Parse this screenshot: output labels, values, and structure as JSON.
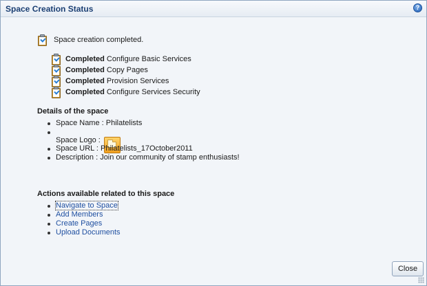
{
  "dialog": {
    "title": "Space Creation Status",
    "help_icon": "help-icon",
    "help_glyph": "?"
  },
  "status": {
    "message": "Space creation completed.",
    "icon": "clipboard-check-icon"
  },
  "tasks": [
    {
      "state": "Completed",
      "name": "Configure Basic Services"
    },
    {
      "state": "Completed",
      "name": "Copy Pages"
    },
    {
      "state": "Completed",
      "name": "Provision Services"
    },
    {
      "state": "Completed",
      "name": "Configure Services Security"
    }
  ],
  "details": {
    "heading": "Details of the space",
    "name_label": "Space Name : Philatelists",
    "logo_label": "Space Logo :",
    "logo_icon": "space-logo-folder-icon",
    "url_label": "Space URL : Philatelists_17October2011",
    "description_label": "Description : Join our community of stamp enthusiasts!"
  },
  "actions": {
    "heading": "Actions available related to this space",
    "links": [
      "Navigate to Space",
      "Add Members",
      "Create Pages",
      "Upload Documents"
    ]
  },
  "footer": {
    "close_label": "Close"
  },
  "colors": {
    "title": "#1b3f73",
    "link": "#1f4fa0",
    "dialog_bg": "#f2f5f9",
    "border": "#8fa6bf"
  }
}
